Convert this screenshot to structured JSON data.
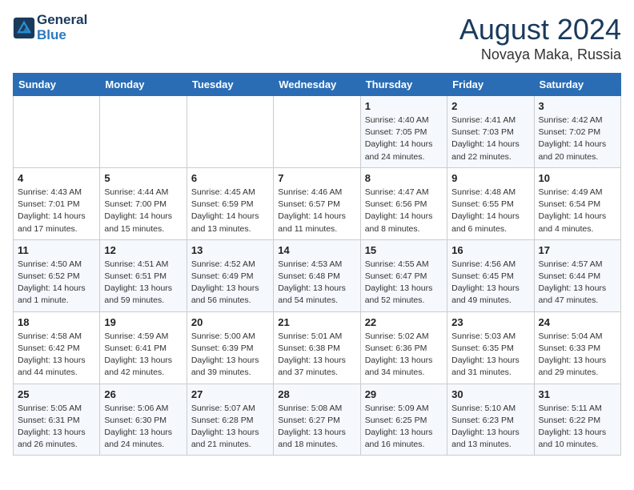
{
  "logo": {
    "line1": "General",
    "line2": "Blue"
  },
  "title": "August 2024",
  "subtitle": "Novaya Maka, Russia",
  "days_of_week": [
    "Sunday",
    "Monday",
    "Tuesday",
    "Wednesday",
    "Thursday",
    "Friday",
    "Saturday"
  ],
  "weeks": [
    [
      {
        "num": "",
        "info": ""
      },
      {
        "num": "",
        "info": ""
      },
      {
        "num": "",
        "info": ""
      },
      {
        "num": "",
        "info": ""
      },
      {
        "num": "1",
        "info": "Sunrise: 4:40 AM\nSunset: 7:05 PM\nDaylight: 14 hours\nand 24 minutes."
      },
      {
        "num": "2",
        "info": "Sunrise: 4:41 AM\nSunset: 7:03 PM\nDaylight: 14 hours\nand 22 minutes."
      },
      {
        "num": "3",
        "info": "Sunrise: 4:42 AM\nSunset: 7:02 PM\nDaylight: 14 hours\nand 20 minutes."
      }
    ],
    [
      {
        "num": "4",
        "info": "Sunrise: 4:43 AM\nSunset: 7:01 PM\nDaylight: 14 hours\nand 17 minutes."
      },
      {
        "num": "5",
        "info": "Sunrise: 4:44 AM\nSunset: 7:00 PM\nDaylight: 14 hours\nand 15 minutes."
      },
      {
        "num": "6",
        "info": "Sunrise: 4:45 AM\nSunset: 6:59 PM\nDaylight: 14 hours\nand 13 minutes."
      },
      {
        "num": "7",
        "info": "Sunrise: 4:46 AM\nSunset: 6:57 PM\nDaylight: 14 hours\nand 11 minutes."
      },
      {
        "num": "8",
        "info": "Sunrise: 4:47 AM\nSunset: 6:56 PM\nDaylight: 14 hours\nand 8 minutes."
      },
      {
        "num": "9",
        "info": "Sunrise: 4:48 AM\nSunset: 6:55 PM\nDaylight: 14 hours\nand 6 minutes."
      },
      {
        "num": "10",
        "info": "Sunrise: 4:49 AM\nSunset: 6:54 PM\nDaylight: 14 hours\nand 4 minutes."
      }
    ],
    [
      {
        "num": "11",
        "info": "Sunrise: 4:50 AM\nSunset: 6:52 PM\nDaylight: 14 hours\nand 1 minute."
      },
      {
        "num": "12",
        "info": "Sunrise: 4:51 AM\nSunset: 6:51 PM\nDaylight: 13 hours\nand 59 minutes."
      },
      {
        "num": "13",
        "info": "Sunrise: 4:52 AM\nSunset: 6:49 PM\nDaylight: 13 hours\nand 56 minutes."
      },
      {
        "num": "14",
        "info": "Sunrise: 4:53 AM\nSunset: 6:48 PM\nDaylight: 13 hours\nand 54 minutes."
      },
      {
        "num": "15",
        "info": "Sunrise: 4:55 AM\nSunset: 6:47 PM\nDaylight: 13 hours\nand 52 minutes."
      },
      {
        "num": "16",
        "info": "Sunrise: 4:56 AM\nSunset: 6:45 PM\nDaylight: 13 hours\nand 49 minutes."
      },
      {
        "num": "17",
        "info": "Sunrise: 4:57 AM\nSunset: 6:44 PM\nDaylight: 13 hours\nand 47 minutes."
      }
    ],
    [
      {
        "num": "18",
        "info": "Sunrise: 4:58 AM\nSunset: 6:42 PM\nDaylight: 13 hours\nand 44 minutes."
      },
      {
        "num": "19",
        "info": "Sunrise: 4:59 AM\nSunset: 6:41 PM\nDaylight: 13 hours\nand 42 minutes."
      },
      {
        "num": "20",
        "info": "Sunrise: 5:00 AM\nSunset: 6:39 PM\nDaylight: 13 hours\nand 39 minutes."
      },
      {
        "num": "21",
        "info": "Sunrise: 5:01 AM\nSunset: 6:38 PM\nDaylight: 13 hours\nand 37 minutes."
      },
      {
        "num": "22",
        "info": "Sunrise: 5:02 AM\nSunset: 6:36 PM\nDaylight: 13 hours\nand 34 minutes."
      },
      {
        "num": "23",
        "info": "Sunrise: 5:03 AM\nSunset: 6:35 PM\nDaylight: 13 hours\nand 31 minutes."
      },
      {
        "num": "24",
        "info": "Sunrise: 5:04 AM\nSunset: 6:33 PM\nDaylight: 13 hours\nand 29 minutes."
      }
    ],
    [
      {
        "num": "25",
        "info": "Sunrise: 5:05 AM\nSunset: 6:31 PM\nDaylight: 13 hours\nand 26 minutes."
      },
      {
        "num": "26",
        "info": "Sunrise: 5:06 AM\nSunset: 6:30 PM\nDaylight: 13 hours\nand 24 minutes."
      },
      {
        "num": "27",
        "info": "Sunrise: 5:07 AM\nSunset: 6:28 PM\nDaylight: 13 hours\nand 21 minutes."
      },
      {
        "num": "28",
        "info": "Sunrise: 5:08 AM\nSunset: 6:27 PM\nDaylight: 13 hours\nand 18 minutes."
      },
      {
        "num": "29",
        "info": "Sunrise: 5:09 AM\nSunset: 6:25 PM\nDaylight: 13 hours\nand 16 minutes."
      },
      {
        "num": "30",
        "info": "Sunrise: 5:10 AM\nSunset: 6:23 PM\nDaylight: 13 hours\nand 13 minutes."
      },
      {
        "num": "31",
        "info": "Sunrise: 5:11 AM\nSunset: 6:22 PM\nDaylight: 13 hours\nand 10 minutes."
      }
    ]
  ]
}
